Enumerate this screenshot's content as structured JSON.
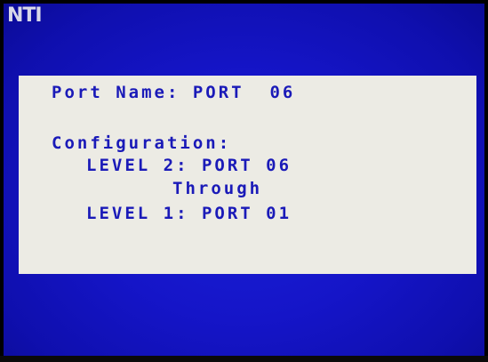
{
  "logo": "NTI",
  "osd": {
    "port_name_line": "Port Name: PORT  06",
    "configuration_heading": "Configuration:",
    "level2_line": "LEVEL 2: PORT 06",
    "through_line": "Through",
    "level1_line": "LEVEL 1: PORT 01"
  },
  "colors": {
    "screen_background": "#1515c8",
    "panel_background": "#ecebe4",
    "text": "#1a1ab8"
  }
}
